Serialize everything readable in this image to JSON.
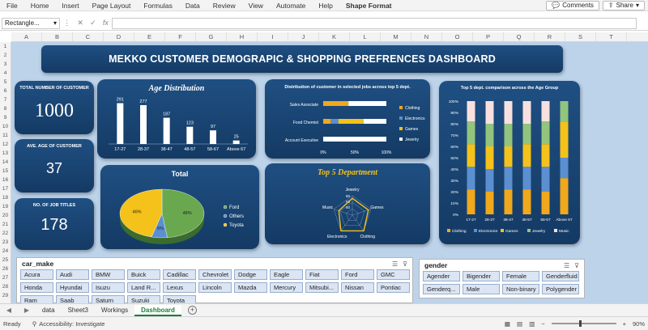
{
  "ribbon": {
    "tabs": [
      "File",
      "Home",
      "Insert",
      "Page Layout",
      "Formulas",
      "Data",
      "Review",
      "View",
      "Automate",
      "Help",
      "Shape Format"
    ],
    "active_tab": "Shape Format",
    "comments_label": "Comments",
    "share_label": "Share"
  },
  "formula_bar": {
    "name_box": "Rectangle...",
    "fx_label": "fx",
    "cancel_glyph": "✕",
    "confirm_glyph": "✓",
    "value": ""
  },
  "columns": [
    "A",
    "B",
    "C",
    "D",
    "E",
    "F",
    "G",
    "H",
    "I",
    "J",
    "K",
    "L",
    "M",
    "N",
    "O",
    "P",
    "Q",
    "R",
    "S",
    "T"
  ],
  "rows": [
    "1",
    "2",
    "3",
    "4",
    "5",
    "6",
    "7",
    "8",
    "9",
    "10",
    "11",
    "12",
    "13",
    "14",
    "15",
    "16",
    "17",
    "18",
    "19",
    "20",
    "21",
    "22",
    "23",
    "24",
    "25",
    "26",
    "27",
    "28",
    "29"
  ],
  "dashboard": {
    "title": "MEKKO CUSTOMER DEMOGRAPIC & SHOPPING PREFRENCES DASHBOARD",
    "kpis": {
      "total_customers": {
        "label": "TOTAL NUMBER OF CUSTOMER",
        "value": "1000"
      },
      "avg_age": {
        "label": "AVE. AGE OF CUSTOMER",
        "value": "37"
      },
      "job_titles": {
        "label": "NO. OF JOB TITLES",
        "value": "178"
      }
    }
  },
  "chart_data": [
    {
      "type": "bar",
      "title": "Age Distribution",
      "categories": [
        "17-27",
        "28-37",
        "38-47",
        "48-57",
        "58-67",
        "Above 67"
      ],
      "values": [
        291,
        277,
        187,
        123,
        97,
        25
      ],
      "ylim": [
        0,
        300
      ],
      "grid": false,
      "bar_color": "#ffffff"
    },
    {
      "type": "bar",
      "orientation": "horizontal",
      "stacked": "percent",
      "title": "Distribution of customer in selected jobs across top 5 dept.",
      "categories": [
        "Sales Associate",
        "Food Chemist",
        "Account Executive"
      ],
      "x_ticks": [
        "0%",
        "50%",
        "100%"
      ],
      "series": [
        {
          "name": "Clothing",
          "color": "#f0a81c",
          "values": [
            40,
            12,
            0
          ]
        },
        {
          "name": "Electronics",
          "color": "#5b8fd0",
          "values": [
            0,
            12,
            0
          ]
        },
        {
          "name": "Games",
          "color": "#f4c21a",
          "values": [
            0,
            40,
            0
          ]
        },
        {
          "name": "Jewelry",
          "color": "#ffffff",
          "values": [
            60,
            36,
            100
          ]
        }
      ],
      "legend": "right"
    },
    {
      "type": "pie",
      "title": "Total",
      "slices": [
        {
          "name": "Ford",
          "value": 48,
          "label": "48%",
          "color": "#6aa84f"
        },
        {
          "name": "Others",
          "value": 6,
          "label": "6%",
          "color": "#5b8fd0"
        },
        {
          "name": "Toyota",
          "value": 46,
          "label": "46%",
          "color": "#f4c21a"
        }
      ],
      "legend": "right"
    },
    {
      "type": "radar",
      "title": "Top 5 Department",
      "axes": [
        "Jewelry",
        "Games",
        "Clothing",
        "Electronics",
        "Music"
      ],
      "ticks": [
        "60",
        "55",
        "50"
      ],
      "values": [
        58,
        58,
        60,
        60,
        56
      ],
      "range": [
        45,
        60
      ]
    },
    {
      "type": "bar",
      "stacked": "percent",
      "title": "Top 5 dept. comparison across the Age Group",
      "categories": [
        "17-27",
        "28-37",
        "38-47",
        "48-57",
        "58-67",
        "Above 67"
      ],
      "y_ticks": [
        "0%",
        "10%",
        "20%",
        "30%",
        "40%",
        "50%",
        "60%",
        "70%",
        "80%",
        "90%",
        "100%"
      ],
      "series": [
        {
          "name": "Clothing",
          "color": "#f0a81c",
          "values": [
            22,
            20,
            22,
            22,
            20,
            32
          ]
        },
        {
          "name": "Electronics",
          "color": "#5b8fd0",
          "values": [
            20,
            20,
            20,
            20,
            22,
            18
          ]
        },
        {
          "name": "Games",
          "color": "#f4c21a",
          "values": [
            20,
            20,
            18,
            20,
            20,
            32
          ]
        },
        {
          "name": "Jewelry",
          "color": "#93c47d",
          "values": [
            20,
            20,
            20,
            18,
            20,
            18
          ]
        },
        {
          "name": "Music",
          "color": "#f8e0df",
          "values": [
            18,
            20,
            20,
            20,
            18,
            0
          ]
        }
      ],
      "legend": "bottom"
    }
  ],
  "slicers": {
    "car_make": {
      "title": "car_make",
      "items": [
        "Acura",
        "Audi",
        "BMW",
        "Buick",
        "Cadillac",
        "Chevrolet",
        "Dodge",
        "Eagle",
        "Fiat",
        "Ford",
        "GMC",
        "Honda",
        "Hyundai",
        "Isuzu",
        "Land R...",
        "Lexus",
        "Lincoln",
        "Mazda",
        "Mercury",
        "Mitsubi...",
        "Nissan",
        "Pontiac",
        "Ram",
        "Saab",
        "Saturn",
        "Suzuki",
        "Toyota"
      ]
    },
    "gender": {
      "title": "gender",
      "items": [
        "Agender",
        "Bigender",
        "Female",
        "Genderfluid",
        "Genderq...",
        "Male",
        "Non-binary",
        "Polygender"
      ]
    }
  },
  "sheets": {
    "tabs": [
      "data",
      "Sheet3",
      "Workings",
      "Dashboard"
    ],
    "active": "Dashboard",
    "nav_prev": "◀",
    "nav_next": "▶",
    "add_label": "+"
  },
  "status": {
    "ready": "Ready",
    "accessibility": "Accessibility: Investigate",
    "zoom": "90%",
    "zoom_out": "−",
    "zoom_in": "+"
  },
  "colors": {
    "panel": "#1f4f82",
    "canvas": "#bcd3ea",
    "slicer_chip": "#dbe5f3",
    "active_sheet": "#1a7f37"
  }
}
